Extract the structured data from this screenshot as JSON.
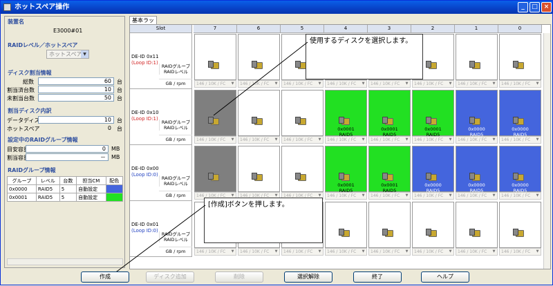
{
  "window": {
    "title": "ホットスペア操作",
    "min": "_",
    "max": "□",
    "close": "×"
  },
  "left": {
    "device_section": "装置名",
    "device_name": "E3000#01",
    "raid_section": "RAIDレベル／ホットスペア",
    "raid_select": "ホットスペア",
    "alloc_section": "ディスク割当情報",
    "total_label": "総数",
    "total_value": "60",
    "assigned_label": "割当済台数",
    "assigned_value": "10",
    "unassigned_label": "未割当台数",
    "unassigned_value": "50",
    "unit": "台",
    "breakdown_section": "割当ディスク内訳",
    "data_disk_label": "データディスク",
    "data_disk_value": "10",
    "hotspare_label": "ホットスペア",
    "hotspare_value": "0",
    "raid_setting_section": "設定中のRAIDグループ情報",
    "target_cap_label": "目安容量",
    "target_cap_value": "0",
    "alloc_cap_label": "割当容量",
    "alloc_cap_value": "－",
    "mb": "MB",
    "rg_section": "RAIDグループ情報",
    "rg_headers": [
      "グループ",
      "レベル",
      "台数",
      "担当CM",
      "配色"
    ],
    "rg_rows": [
      {
        "group": "0x0000",
        "level": "RAID5",
        "count": "5",
        "cm": "自動設定",
        "color": "#4465DD"
      },
      {
        "group": "0x0001",
        "level": "RAID5",
        "count": "5",
        "cm": "自動設定",
        "color": "#22E022"
      }
    ]
  },
  "grid": {
    "tab": "基本ラック",
    "slot_label": "Slot",
    "slots": [
      "7",
      "6",
      "5",
      "4",
      "3",
      "2",
      "1",
      "0"
    ],
    "rg_label": "RAIDグループ",
    "raid_label": "RAIDレベル",
    "gb_label": "GB / rpm",
    "cap_text": "146 / 10K / FC",
    "rows": [
      {
        "de": "DE-ID 0x11",
        "loop": "(Loop ID:1)",
        "loop_color": "#D02020",
        "disks": [
          {
            "s": "w"
          },
          {
            "s": "w"
          },
          {
            "s": "w"
          },
          {
            "s": "w"
          },
          {
            "s": "w"
          },
          {
            "s": "w"
          },
          {
            "s": "w"
          },
          {
            "s": "w"
          }
        ]
      },
      {
        "de": "DE-ID 0x10",
        "loop": "(Loop ID:1)",
        "loop_color": "#D02020",
        "disks": [
          {
            "s": "g"
          },
          {
            "s": "w"
          },
          {
            "s": "w"
          },
          {
            "s": "G",
            "rg": "0x0001",
            "lv": "RAID5"
          },
          {
            "s": "G",
            "rg": "0x0001",
            "lv": "RAID5"
          },
          {
            "s": "G",
            "rg": "0x0001",
            "lv": "RAID5"
          },
          {
            "s": "B",
            "rg": "0x0000",
            "lv": "RAID5"
          },
          {
            "s": "B",
            "rg": "0x0000",
            "lv": "RAID5"
          }
        ]
      },
      {
        "de": "DE-ID 0x00",
        "loop": "(Loop ID:0)",
        "loop_color": "#2040C0",
        "disks": [
          {
            "s": "g"
          },
          {
            "s": "w"
          },
          {
            "s": "w"
          },
          {
            "s": "G",
            "rg": "0x0001",
            "lv": "RAID5"
          },
          {
            "s": "G",
            "rg": "0x0001",
            "lv": "RAID5"
          },
          {
            "s": "B",
            "rg": "0x0000",
            "lv": "RAID5"
          },
          {
            "s": "B",
            "rg": "0x0000",
            "lv": "RAID5"
          },
          {
            "s": "B",
            "rg": "0x0000",
            "lv": "RAID5"
          }
        ]
      },
      {
        "de": "DE-ID 0x01",
        "loop": "(Loop ID:0)",
        "loop_color": "#2040C0",
        "disks": [
          {
            "s": "w"
          },
          {
            "s": "w"
          },
          {
            "s": "w"
          },
          {
            "s": "w"
          },
          {
            "s": "w"
          },
          {
            "s": "w"
          },
          {
            "s": "w"
          },
          {
            "s": "w"
          }
        ]
      }
    ]
  },
  "callouts": {
    "top": "使用するディスクを選択します。",
    "bottom": "[作成]ボタンを押します。"
  },
  "buttons": {
    "create": "作成",
    "add_disk": "ディスク追加",
    "delete": "削除",
    "deselect": "選択解除",
    "finish": "終了",
    "help": "ヘルプ"
  }
}
